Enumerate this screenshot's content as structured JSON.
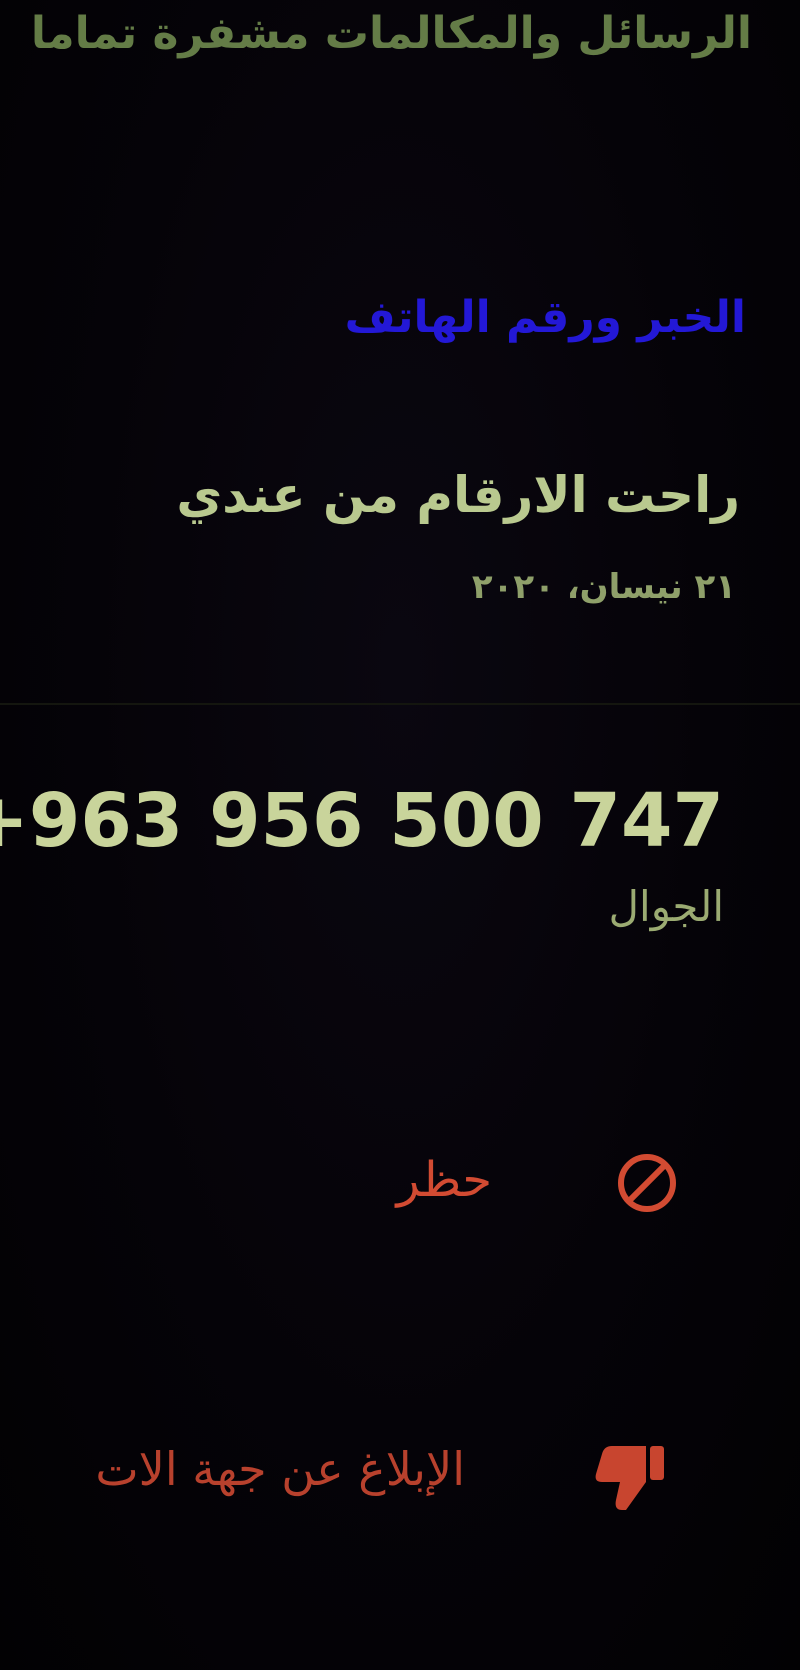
{
  "banner": {
    "encryption_note": "الرسائل والمكالمات مشفرة تماما"
  },
  "about_phone": {
    "section_title": "الخبر ورقم الهاتف",
    "about_text": "راحت الارقام من عندي",
    "about_date": "٢١ نيسان، ٢٠٢٠",
    "phone_number": "+963 956 500 747",
    "phone_type": "الجوال"
  },
  "actions": {
    "block_label": "حظر",
    "block_icon": "block-icon",
    "report_label": "الإبلاغ عن جهة الات",
    "report_icon": "thumbs-down-icon"
  },
  "colors": {
    "title": "#2318d6",
    "text": "#b9c98f",
    "danger": "#d24b32"
  }
}
